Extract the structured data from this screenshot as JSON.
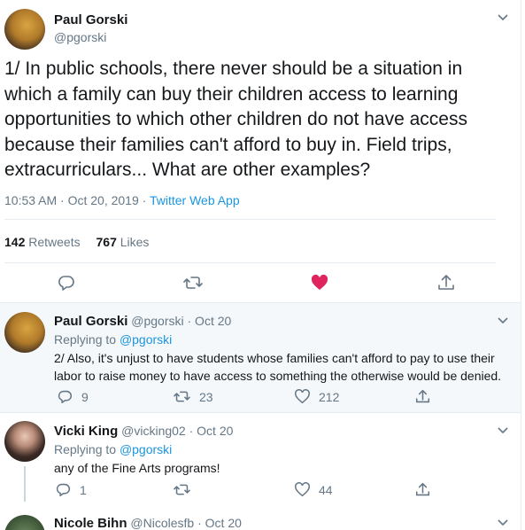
{
  "main_tweet": {
    "author_name": "Paul Gorski",
    "handle": "@pgorski",
    "text": "1/ In public schools, there never should be a situation in which a family can buy their children access to learning opportunities to which other children do not have access because their families can't afford to buy in. Field trips, extracurriculars... What are other examples?",
    "timestamp": "10:53 AM · Oct 20, 2019 · ",
    "source": "Twitter Web App",
    "retweets_count": "142",
    "retweets_label": "Retweets",
    "likes_count": "767",
    "likes_label": "Likes"
  },
  "replies": [
    {
      "author_name": "Paul Gorski",
      "handle": "@pgorski",
      "date": "· Oct 20",
      "replying_to_label": "Replying to ",
      "replying_to_handle": "@pgorski",
      "text": "2/ Also, it's unjust to have students whose families can't afford to pay to use their labor to raise money to have access to something the otherwise would be denied.",
      "reply_count": "9",
      "retweet_count": "23",
      "like_count": "212"
    },
    {
      "author_name": "Vicki King",
      "handle": "@vicking02",
      "date": "· Oct 20",
      "replying_to_label": "Replying to ",
      "replying_to_handle": "@pgorski",
      "text": "any of the Fine Arts programs!",
      "reply_count": "1",
      "retweet_count": "",
      "like_count": "44"
    },
    {
      "author_name": "Nicole Bihn",
      "handle": "@Nicolesfb",
      "date": "· Oct 20"
    }
  ],
  "colors": {
    "like_active": "#e0245e",
    "link": "#1b95e0",
    "muted": "#657786",
    "divider": "#e6ecf0"
  },
  "icons": [
    "chevron-down-icon",
    "reply-icon",
    "retweet-icon",
    "heart-icon",
    "share-icon"
  ]
}
